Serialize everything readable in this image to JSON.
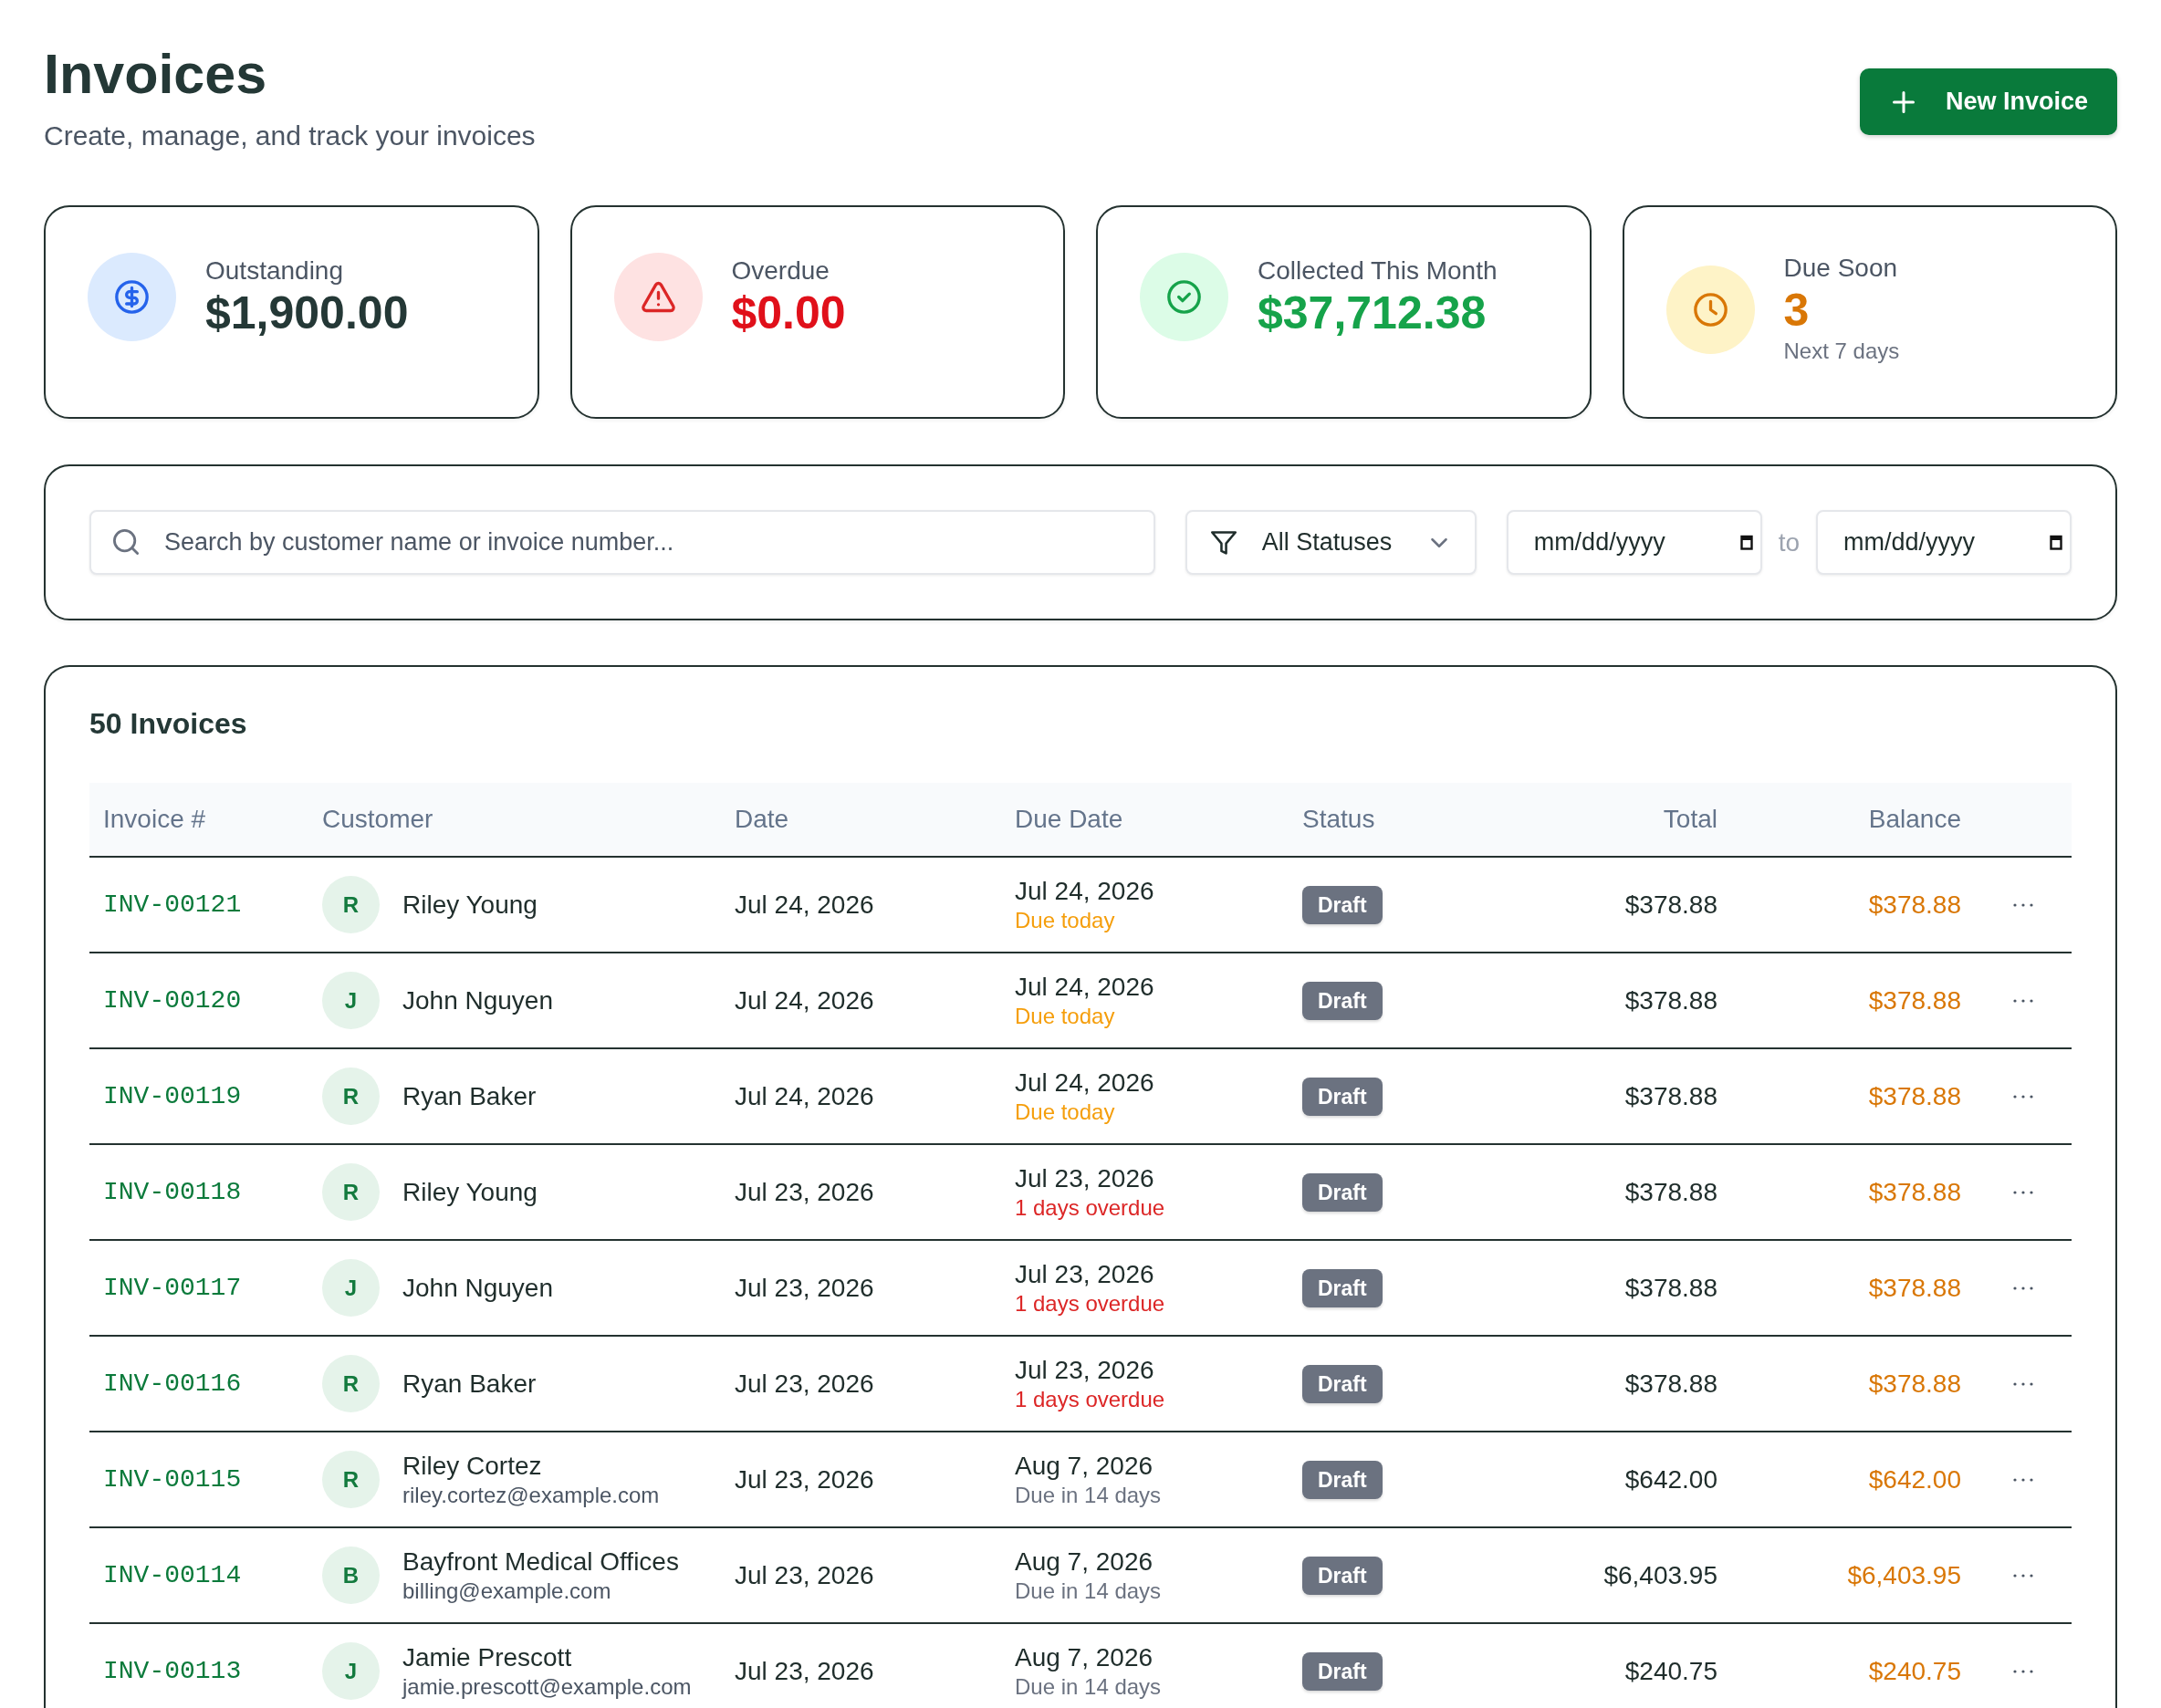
{
  "page": {
    "title": "Invoices",
    "subtitle": "Create, manage, and track your invoices",
    "new_button": "New Invoice"
  },
  "stats": [
    {
      "kind": "outstanding",
      "label": "Outstanding",
      "value": "$1,900.00"
    },
    {
      "kind": "overdue",
      "label": "Overdue",
      "value": "$0.00"
    },
    {
      "kind": "collected",
      "label": "Collected This Month",
      "value": "$37,712.38"
    },
    {
      "kind": "due_soon",
      "label": "Due Soon",
      "value": "3",
      "note": "Next 7 days"
    }
  ],
  "filters": {
    "search": {
      "placeholder": "Search by customer name or invoice number..."
    },
    "status": {
      "value": "All Statuses"
    },
    "date_from": {
      "placeholder": "mm/dd/yyyy"
    },
    "range_separator": "to",
    "date_to": {
      "placeholder": "mm/dd/yyyy"
    }
  },
  "table": {
    "title": "50 Invoices",
    "columns": [
      "Invoice #",
      "Customer",
      "Date",
      "Due Date",
      "Status",
      "Total",
      "Balance"
    ],
    "rows": [
      {
        "invoice": "INV-00121",
        "customer": {
          "initial": "R",
          "name": "Riley Young"
        },
        "date": "Jul 24, 2026",
        "due_date": "Jul 24, 2026",
        "due_note": {
          "kind": "due_today",
          "text": "Due today"
        },
        "status": {
          "kind": "draft",
          "label": "Draft"
        },
        "total": "$378.88",
        "balance": "$378.88"
      },
      {
        "invoice": "INV-00120",
        "customer": {
          "initial": "J",
          "name": "John Nguyen"
        },
        "date": "Jul 24, 2026",
        "due_date": "Jul 24, 2026",
        "due_note": {
          "kind": "due_today",
          "text": "Due today"
        },
        "status": {
          "kind": "draft",
          "label": "Draft"
        },
        "total": "$378.88",
        "balance": "$378.88"
      },
      {
        "invoice": "INV-00119",
        "customer": {
          "initial": "R",
          "name": "Ryan Baker"
        },
        "date": "Jul 24, 2026",
        "due_date": "Jul 24, 2026",
        "due_note": {
          "kind": "due_today",
          "text": "Due today"
        },
        "status": {
          "kind": "draft",
          "label": "Draft"
        },
        "total": "$378.88",
        "balance": "$378.88"
      },
      {
        "invoice": "INV-00118",
        "customer": {
          "initial": "R",
          "name": "Riley Young"
        },
        "date": "Jul 23, 2026",
        "due_date": "Jul 23, 2026",
        "due_note": {
          "kind": "overdue",
          "text": "1 days overdue"
        },
        "status": {
          "kind": "draft",
          "label": "Draft"
        },
        "total": "$378.88",
        "balance": "$378.88"
      },
      {
        "invoice": "INV-00117",
        "customer": {
          "initial": "J",
          "name": "John Nguyen"
        },
        "date": "Jul 23, 2026",
        "due_date": "Jul 23, 2026",
        "due_note": {
          "kind": "overdue",
          "text": "1 days overdue"
        },
        "status": {
          "kind": "draft",
          "label": "Draft"
        },
        "total": "$378.88",
        "balance": "$378.88"
      },
      {
        "invoice": "INV-00116",
        "customer": {
          "initial": "R",
          "name": "Ryan Baker"
        },
        "date": "Jul 23, 2026",
        "due_date": "Jul 23, 2026",
        "due_note": {
          "kind": "overdue",
          "text": "1 days overdue"
        },
        "status": {
          "kind": "draft",
          "label": "Draft"
        },
        "total": "$378.88",
        "balance": "$378.88"
      },
      {
        "invoice": "INV-00115",
        "customer": {
          "initial": "R",
          "name": "Riley Cortez",
          "email": "riley.cortez@example.com"
        },
        "date": "Jul 23, 2026",
        "due_date": "Aug 7, 2026",
        "due_note": {
          "kind": "upcoming",
          "text": "Due in 14 days"
        },
        "status": {
          "kind": "draft",
          "label": "Draft"
        },
        "total": "$642.00",
        "balance": "$642.00"
      },
      {
        "invoice": "INV-00114",
        "customer": {
          "initial": "B",
          "name": "Bayfront Medical Offices",
          "email": "billing@example.com"
        },
        "date": "Jul 23, 2026",
        "due_date": "Aug 7, 2026",
        "due_note": {
          "kind": "upcoming",
          "text": "Due in 14 days"
        },
        "status": {
          "kind": "draft",
          "label": "Draft"
        },
        "total": "$6,403.95",
        "balance": "$6,403.95"
      },
      {
        "invoice": "INV-00113",
        "customer": {
          "initial": "J",
          "name": "Jamie Prescott",
          "email": "jamie.prescott@example.com"
        },
        "date": "Jul 23, 2026",
        "due_date": "Aug 7, 2026",
        "due_note": {
          "kind": "upcoming",
          "text": "Due in 14 days"
        },
        "status": {
          "kind": "draft",
          "label": "Draft"
        },
        "total": "$240.75",
        "balance": "$240.75"
      }
    ]
  }
}
